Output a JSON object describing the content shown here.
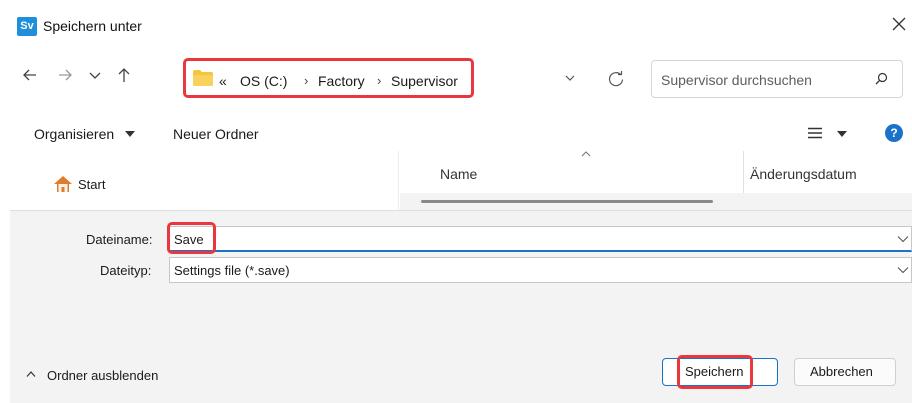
{
  "window": {
    "app_icon_text": "Sv",
    "title": "Speichern unter"
  },
  "navigation": {
    "breadcrumb": {
      "overflow": "«",
      "items": [
        "OS (C:)",
        "Factory",
        "Supervisor"
      ],
      "separator": "›"
    },
    "search": {
      "placeholder": "Supervisor durchsuchen"
    }
  },
  "commandbar": {
    "organize_label": "Organisieren",
    "new_folder_label": "Neuer Ordner"
  },
  "nav_pane": {
    "items": [
      {
        "label": "Start",
        "icon": "home-icon"
      }
    ]
  },
  "file_list": {
    "columns": [
      "Name",
      "Änderungsdatum"
    ]
  },
  "form": {
    "filename_label": "Dateiname:",
    "filename_value": "Save",
    "filetype_label": "Dateityp:",
    "filetype_value": "Settings file (*.save)"
  },
  "footer": {
    "hide_folders_label": "Ordner ausblenden",
    "save_label": "Speichern",
    "cancel_label": "Abbrechen"
  },
  "colors": {
    "accent": "#1a73c8",
    "highlight": "#e8383d",
    "folder": "#f4c53a",
    "home_roof": "#e07b2c"
  }
}
